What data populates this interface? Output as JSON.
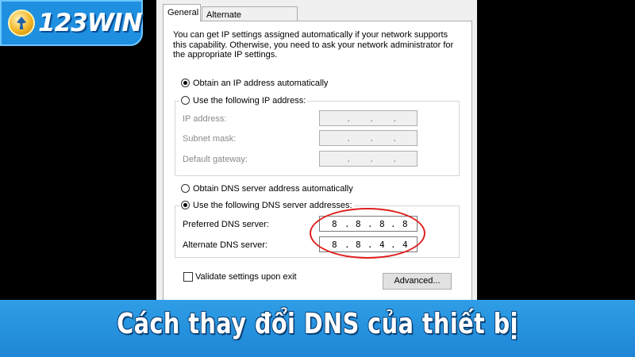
{
  "logo": {
    "text": "123WIN"
  },
  "tabs": [
    "General",
    "Alternate Configuration"
  ],
  "description": "You can get IP settings assigned automatically if your network supports this capability. Otherwise, you need to ask your network administrator for the appropriate IP settings.",
  "ip": {
    "auto_label": "Obtain an IP address automatically",
    "auto_selected": true,
    "manual_label": "Use the following IP address:",
    "address_label": "IP address:",
    "subnet_label": "Subnet mask:",
    "gateway_label": "Default gateway:",
    "dot": "."
  },
  "dns": {
    "auto_label": "Obtain DNS server address automatically",
    "manual_label": "Use the following DNS server addresses:",
    "manual_selected": true,
    "preferred_label": "Preferred DNS server:",
    "preferred": [
      "8",
      "8",
      "8",
      "8"
    ],
    "alternate_label": "Alternate DNS server:",
    "alternate": [
      "8",
      "8",
      "4",
      "4"
    ]
  },
  "validate_label": "Validate settings upon exit",
  "validate_checked": false,
  "advanced_button": "Advanced...",
  "banner": {
    "title": "Cách thay đổi DNS của thiết bị"
  },
  "colors": {
    "banner": "#1e86d6",
    "highlight": "#e02020",
    "logo_bg": "#1f8fe0"
  }
}
